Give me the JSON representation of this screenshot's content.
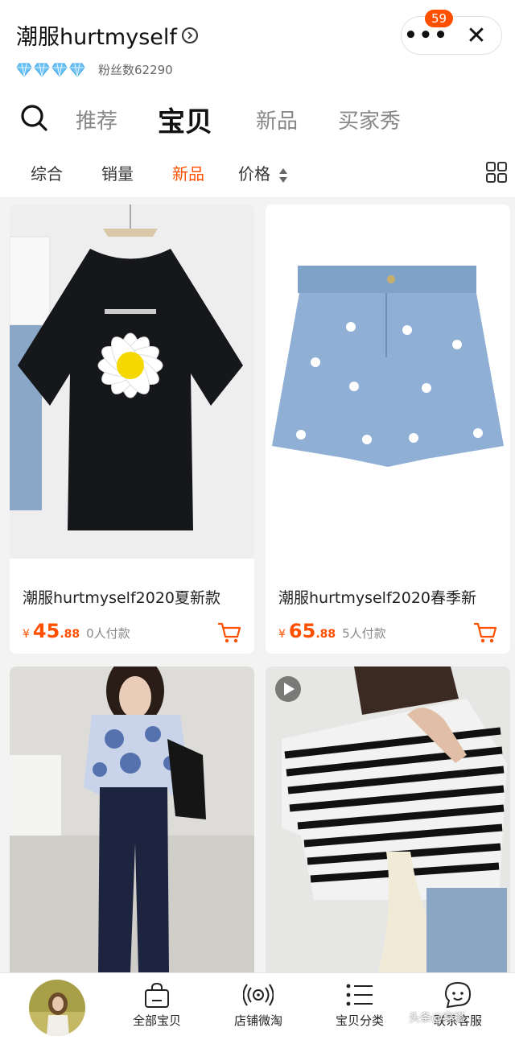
{
  "header": {
    "shop_name": "潮服hurtmyself",
    "fans_label": "粉丝数62290",
    "badge_count": "59",
    "more_label": "•••",
    "close_label": "✕"
  },
  "tabs": [
    {
      "label": "推荐"
    },
    {
      "label": "宝贝"
    },
    {
      "label": "新品"
    },
    {
      "label": "买家秀"
    }
  ],
  "sort": [
    {
      "label": "综合"
    },
    {
      "label": "销量"
    },
    {
      "label": "新品"
    },
    {
      "label": "价格"
    }
  ],
  "products": [
    {
      "title": "潮服hurtmyself2020夏新款",
      "currency": "¥",
      "price_main": "45",
      "price_dec": ".88",
      "sold": "0人付款"
    },
    {
      "title": "潮服hurtmyself2020春季新",
      "currency": "¥",
      "price_main": "65",
      "price_dec": ".88",
      "sold": "5人付款"
    }
  ],
  "bottom": [
    {
      "label": "全部宝贝",
      "icon": "bag-icon"
    },
    {
      "label": "店铺微淘",
      "icon": "broadcast-icon"
    },
    {
      "label": "宝贝分类",
      "icon": "list-icon"
    },
    {
      "label": "联系客服",
      "icon": "chat-face-icon"
    }
  ],
  "watermark": "头条@穿搭",
  "colors": {
    "accent": "#ff5000",
    "background": "#f3f3f3"
  }
}
